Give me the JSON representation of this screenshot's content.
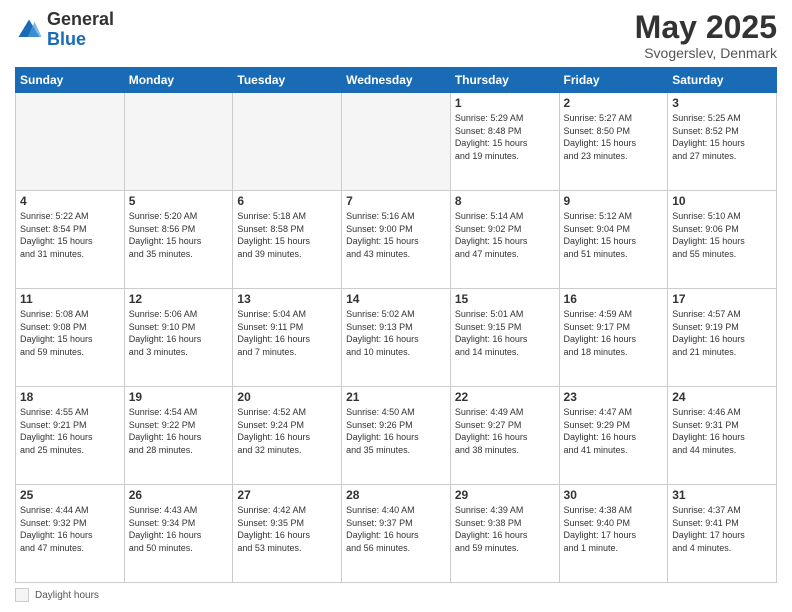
{
  "header": {
    "logo_general": "General",
    "logo_blue": "Blue",
    "title": "May 2025",
    "subtitle": "Svogerslev, Denmark"
  },
  "days_of_week": [
    "Sunday",
    "Monday",
    "Tuesday",
    "Wednesday",
    "Thursday",
    "Friday",
    "Saturday"
  ],
  "weeks": [
    [
      {
        "day": "",
        "info": ""
      },
      {
        "day": "",
        "info": ""
      },
      {
        "day": "",
        "info": ""
      },
      {
        "day": "",
        "info": ""
      },
      {
        "day": "1",
        "info": "Sunrise: 5:29 AM\nSunset: 8:48 PM\nDaylight: 15 hours\nand 19 minutes."
      },
      {
        "day": "2",
        "info": "Sunrise: 5:27 AM\nSunset: 8:50 PM\nDaylight: 15 hours\nand 23 minutes."
      },
      {
        "day": "3",
        "info": "Sunrise: 5:25 AM\nSunset: 8:52 PM\nDaylight: 15 hours\nand 27 minutes."
      }
    ],
    [
      {
        "day": "4",
        "info": "Sunrise: 5:22 AM\nSunset: 8:54 PM\nDaylight: 15 hours\nand 31 minutes."
      },
      {
        "day": "5",
        "info": "Sunrise: 5:20 AM\nSunset: 8:56 PM\nDaylight: 15 hours\nand 35 minutes."
      },
      {
        "day": "6",
        "info": "Sunrise: 5:18 AM\nSunset: 8:58 PM\nDaylight: 15 hours\nand 39 minutes."
      },
      {
        "day": "7",
        "info": "Sunrise: 5:16 AM\nSunset: 9:00 PM\nDaylight: 15 hours\nand 43 minutes."
      },
      {
        "day": "8",
        "info": "Sunrise: 5:14 AM\nSunset: 9:02 PM\nDaylight: 15 hours\nand 47 minutes."
      },
      {
        "day": "9",
        "info": "Sunrise: 5:12 AM\nSunset: 9:04 PM\nDaylight: 15 hours\nand 51 minutes."
      },
      {
        "day": "10",
        "info": "Sunrise: 5:10 AM\nSunset: 9:06 PM\nDaylight: 15 hours\nand 55 minutes."
      }
    ],
    [
      {
        "day": "11",
        "info": "Sunrise: 5:08 AM\nSunset: 9:08 PM\nDaylight: 15 hours\nand 59 minutes."
      },
      {
        "day": "12",
        "info": "Sunrise: 5:06 AM\nSunset: 9:10 PM\nDaylight: 16 hours\nand 3 minutes."
      },
      {
        "day": "13",
        "info": "Sunrise: 5:04 AM\nSunset: 9:11 PM\nDaylight: 16 hours\nand 7 minutes."
      },
      {
        "day": "14",
        "info": "Sunrise: 5:02 AM\nSunset: 9:13 PM\nDaylight: 16 hours\nand 10 minutes."
      },
      {
        "day": "15",
        "info": "Sunrise: 5:01 AM\nSunset: 9:15 PM\nDaylight: 16 hours\nand 14 minutes."
      },
      {
        "day": "16",
        "info": "Sunrise: 4:59 AM\nSunset: 9:17 PM\nDaylight: 16 hours\nand 18 minutes."
      },
      {
        "day": "17",
        "info": "Sunrise: 4:57 AM\nSunset: 9:19 PM\nDaylight: 16 hours\nand 21 minutes."
      }
    ],
    [
      {
        "day": "18",
        "info": "Sunrise: 4:55 AM\nSunset: 9:21 PM\nDaylight: 16 hours\nand 25 minutes."
      },
      {
        "day": "19",
        "info": "Sunrise: 4:54 AM\nSunset: 9:22 PM\nDaylight: 16 hours\nand 28 minutes."
      },
      {
        "day": "20",
        "info": "Sunrise: 4:52 AM\nSunset: 9:24 PM\nDaylight: 16 hours\nand 32 minutes."
      },
      {
        "day": "21",
        "info": "Sunrise: 4:50 AM\nSunset: 9:26 PM\nDaylight: 16 hours\nand 35 minutes."
      },
      {
        "day": "22",
        "info": "Sunrise: 4:49 AM\nSunset: 9:27 PM\nDaylight: 16 hours\nand 38 minutes."
      },
      {
        "day": "23",
        "info": "Sunrise: 4:47 AM\nSunset: 9:29 PM\nDaylight: 16 hours\nand 41 minutes."
      },
      {
        "day": "24",
        "info": "Sunrise: 4:46 AM\nSunset: 9:31 PM\nDaylight: 16 hours\nand 44 minutes."
      }
    ],
    [
      {
        "day": "25",
        "info": "Sunrise: 4:44 AM\nSunset: 9:32 PM\nDaylight: 16 hours\nand 47 minutes."
      },
      {
        "day": "26",
        "info": "Sunrise: 4:43 AM\nSunset: 9:34 PM\nDaylight: 16 hours\nand 50 minutes."
      },
      {
        "day": "27",
        "info": "Sunrise: 4:42 AM\nSunset: 9:35 PM\nDaylight: 16 hours\nand 53 minutes."
      },
      {
        "day": "28",
        "info": "Sunrise: 4:40 AM\nSunset: 9:37 PM\nDaylight: 16 hours\nand 56 minutes."
      },
      {
        "day": "29",
        "info": "Sunrise: 4:39 AM\nSunset: 9:38 PM\nDaylight: 16 hours\nand 59 minutes."
      },
      {
        "day": "30",
        "info": "Sunrise: 4:38 AM\nSunset: 9:40 PM\nDaylight: 17 hours\nand 1 minute."
      },
      {
        "day": "31",
        "info": "Sunrise: 4:37 AM\nSunset: 9:41 PM\nDaylight: 17 hours\nand 4 minutes."
      }
    ]
  ],
  "legend": {
    "label": "Daylight hours"
  }
}
